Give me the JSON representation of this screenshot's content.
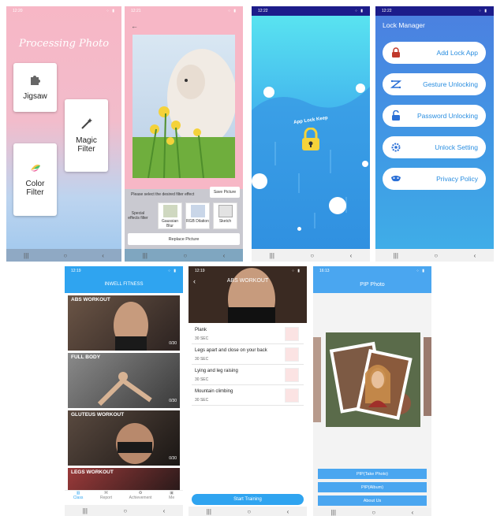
{
  "colors": {
    "pink": "#f7b7c6",
    "blue": "#3f9be5",
    "navy": "#2a8ee0",
    "fitness_blue": "#2fa4f0"
  },
  "phone1": {
    "time": "12:20",
    "title": "Processing Photo",
    "cards": [
      {
        "label": "Jigsaw",
        "icon": "puzzle-icon"
      },
      {
        "label": "Magic Filter",
        "icon": "magic-wand-icon"
      },
      {
        "label": "Color Filter",
        "icon": "color-palette-icon"
      }
    ]
  },
  "phone2": {
    "time": "12:21",
    "instruction": "Please select the desired filter effect",
    "save_label": "Save Picture",
    "effects_label": "Special effects filter",
    "filters": [
      "Gaussian Blur",
      "RGB Dilation",
      "Sketch"
    ],
    "replace_label": "Replace Picture"
  },
  "phone3": {
    "time": "12:22",
    "logo_text": "App Lock Keep"
  },
  "phone4": {
    "time": "12:22",
    "header": "Lock Manager",
    "buttons": [
      {
        "label": "Add Lock App",
        "icon": "lock-icon"
      },
      {
        "label": "Gesture Unlocking",
        "icon": "gesture-icon"
      },
      {
        "label": "Password Unlocking",
        "icon": "unlock-icon"
      },
      {
        "label": "Unlock Setting",
        "icon": "gear-icon"
      },
      {
        "label": "Privacy Policy",
        "icon": "mask-icon"
      }
    ]
  },
  "phone5": {
    "time": "12:19",
    "header": "INWELL FITNESS",
    "workouts": [
      {
        "label": "ABS WORKOUT",
        "count": "0/30"
      },
      {
        "label": "FULL BODY",
        "count": "0/30"
      },
      {
        "label": "GLUTEUS WORKOUT",
        "count": "0/30"
      },
      {
        "label": "LEGS WORKOUT",
        "count": ""
      }
    ],
    "tabs": [
      "Class",
      "Report",
      "Achievement",
      "Me"
    ]
  },
  "phone6": {
    "time": "12:19",
    "title": "ABS WORKOUT",
    "exercises": [
      {
        "name": "Plank",
        "duration": "30 SEC"
      },
      {
        "name": "Legs apart and close on your back",
        "duration": "30 SEC"
      },
      {
        "name": "Lying and leg raising",
        "duration": "30 SEC"
      },
      {
        "name": "Mountain climbing",
        "duration": "30 SEC"
      }
    ],
    "start_label": "Start Training"
  },
  "phone7": {
    "time": "16:13",
    "header": "PIP Photo",
    "buttons": [
      "PIP(Take Photo)",
      "PIP(Album)",
      "About Us"
    ]
  }
}
